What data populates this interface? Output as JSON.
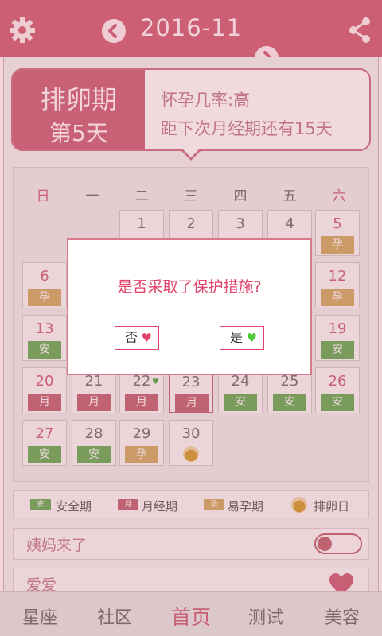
{
  "header": {
    "month": "2016-11",
    "colors": {
      "bar": "#c95a70",
      "accent": "#e0446a",
      "safe": "#63a453",
      "period": "#b95d6c",
      "fertile": "#c8a25f"
    }
  },
  "card": {
    "phase": "排卵期",
    "day": "第5天",
    "pregnancy": "怀孕几率:高",
    "next_period": "距下次月经期还有15天"
  },
  "weekdays": [
    "日",
    "一",
    "二",
    "三",
    "四",
    "五",
    "六"
  ],
  "days": [
    {
      "num": "1",
      "tag": ""
    },
    {
      "num": "2",
      "tag": ""
    },
    {
      "num": "3",
      "tag": ""
    },
    {
      "num": "4",
      "tag": ""
    },
    {
      "num": "5",
      "tag": "孕"
    },
    {
      "num": "6",
      "tag": "孕"
    },
    {
      "num": "12",
      "tag": "孕"
    },
    {
      "num": "13",
      "tag": "安"
    },
    {
      "num": "19",
      "tag": "安"
    },
    {
      "num": "20",
      "tag": "月"
    },
    {
      "num": "21",
      "tag": "月"
    },
    {
      "num": "22",
      "tag": "月"
    },
    {
      "num": "23",
      "tag": "月"
    },
    {
      "num": "24",
      "tag": "安"
    },
    {
      "num": "25",
      "tag": "安"
    },
    {
      "num": "26",
      "tag": "安"
    },
    {
      "num": "27",
      "tag": "安"
    },
    {
      "num": "28",
      "tag": "安"
    },
    {
      "num": "29",
      "tag": "孕"
    },
    {
      "num": "30",
      "tag": ""
    }
  ],
  "legend": {
    "safe": "安全期",
    "safe_mark": "安",
    "period": "月经期",
    "period_mark": "月",
    "fertile": "易孕期",
    "fertile_mark": "孕",
    "ovulation": "排卵日"
  },
  "rows": {
    "aunt": "姨妈来了",
    "love": "爱爱"
  },
  "tabs": [
    "星座",
    "社区",
    "首页",
    "测试",
    "美容"
  ],
  "dialog": {
    "question": "是否采取了保护措施?",
    "no": "否",
    "yes": "是"
  }
}
